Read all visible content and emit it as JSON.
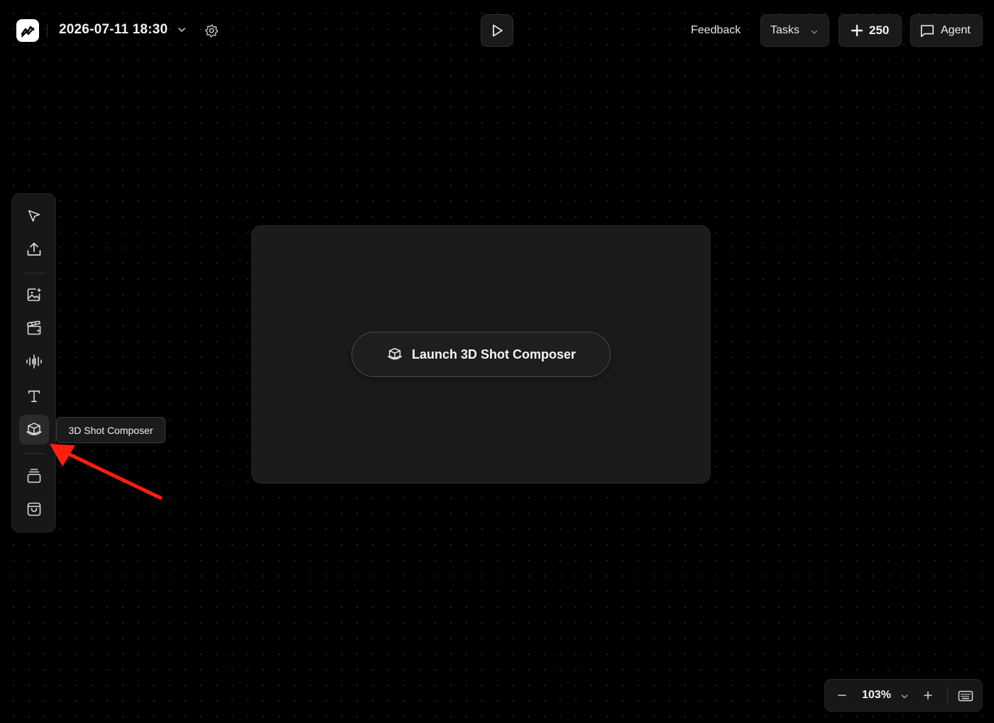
{
  "header": {
    "project_title": "2026-07-11 18:30",
    "feedback_label": "Feedback",
    "tasks_label": "Tasks",
    "credits_value": "250",
    "agent_label": "Agent"
  },
  "sidebar": {
    "tools": [
      {
        "name": "select",
        "icon": "cursor-icon"
      },
      {
        "name": "upload",
        "icon": "upload-icon"
      },
      {
        "name": "image-generation",
        "icon": "image-sparkle-icon"
      },
      {
        "name": "video-generation",
        "icon": "clapperboard-icon"
      },
      {
        "name": "audio",
        "icon": "waveform-icon"
      },
      {
        "name": "text",
        "icon": "text-icon"
      },
      {
        "name": "3d-shot-composer",
        "icon": "cube-icon",
        "active": true
      },
      {
        "name": "layers",
        "icon": "stack-icon"
      },
      {
        "name": "assets",
        "icon": "bag-icon"
      }
    ],
    "tooltip": "3D Shot Composer"
  },
  "card": {
    "launch_label": "Launch 3D Shot Composer"
  },
  "zoom": {
    "value": "103%"
  },
  "colors": {
    "background": "#000000",
    "panel": "#171717",
    "card": "#1b1b1b",
    "annotation_arrow": "#ff1f0f"
  }
}
